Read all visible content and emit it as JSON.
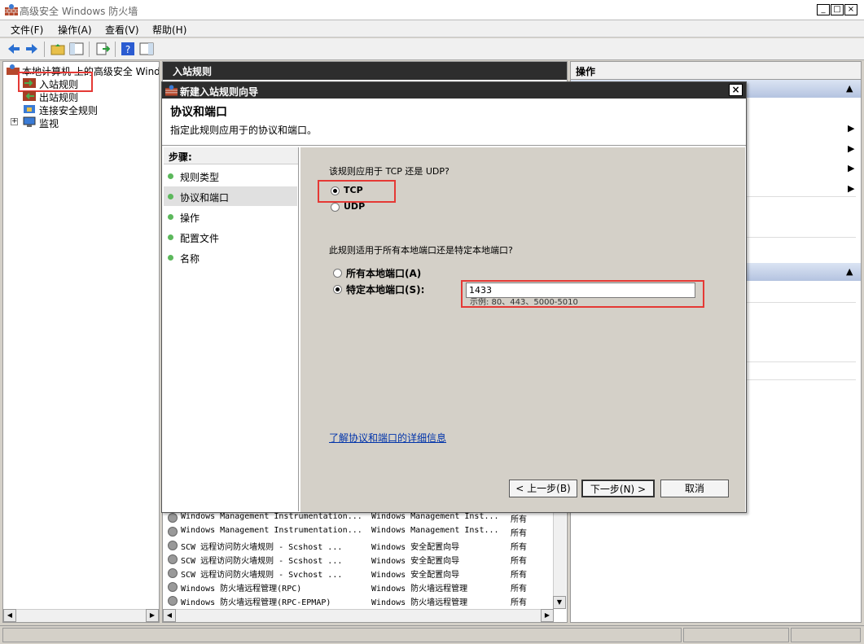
{
  "window": {
    "title": "高级安全 Windows 防火墙",
    "min": "_",
    "max": "□",
    "close": "×"
  },
  "menu": [
    "文件(F)",
    "操作(A)",
    "查看(V)",
    "帮助(H)"
  ],
  "tree": {
    "root": "本地计算机 上的高级安全 Windows 防火墙",
    "items": [
      "入站规则",
      "出站规则",
      "连接安全规则",
      "监视"
    ],
    "expander": "+"
  },
  "center": {
    "header": "入站规则",
    "rows": [
      [
        "Windows Management Instrumentation...",
        "Windows Management Inst...",
        "所有"
      ],
      [
        "Windows Management Instrumentation...",
        "Windows Management Inst...",
        "所有"
      ],
      [
        "SCW 远程访问防火墙规则 - Scshost ...",
        "Windows 安全配置向导",
        "所有"
      ],
      [
        "SCW 远程访问防火墙规则 - Scshost ...",
        "Windows 安全配置向导",
        "所有"
      ],
      [
        "SCW 远程访问防火墙规则 - Svchost ...",
        "Windows 安全配置向导",
        "所有"
      ],
      [
        "Windows 防火墙远程管理(RPC)",
        "Windows 防火墙远程管理",
        "所有"
      ],
      [
        "Windows 防火墙远程管理(RPC-EPMAP)",
        "Windows 防火墙远程管理",
        "所有"
      ]
    ]
  },
  "actions": {
    "header": "操作",
    "arrow": "▶",
    "collapse": "▲"
  },
  "dialog": {
    "title": "新建入站规则向导",
    "close": "×",
    "heading": "协议和端口",
    "subheading": "指定此规则应用于的协议和端口。",
    "steps_title": "步骤:",
    "steps": [
      "规则类型",
      "协议和端口",
      "操作",
      "配置文件",
      "名称"
    ],
    "active_step": 1,
    "protocol_question": "该规则应用于 TCP 还是 UDP?",
    "protocol_options": [
      "TCP",
      "UDP"
    ],
    "protocol_selected": "TCP",
    "port_question": "此规则适用于所有本地端口还是特定本地端口?",
    "port_options": [
      "所有本地端口(A)",
      "特定本地端口(S):"
    ],
    "port_selected": "特定本地端口(S):",
    "port_value": "1433",
    "port_example": "示例: 80、443、5000-5010",
    "learn_more": "了解协议和端口的详细信息",
    "buttons": {
      "back": "< 上一步(B)",
      "next": "下一步(N) >",
      "cancel": "取消"
    }
  },
  "colors": {
    "highlight": "#e53935",
    "title_dark": "#2d2d2d",
    "link": "#0033aa"
  }
}
